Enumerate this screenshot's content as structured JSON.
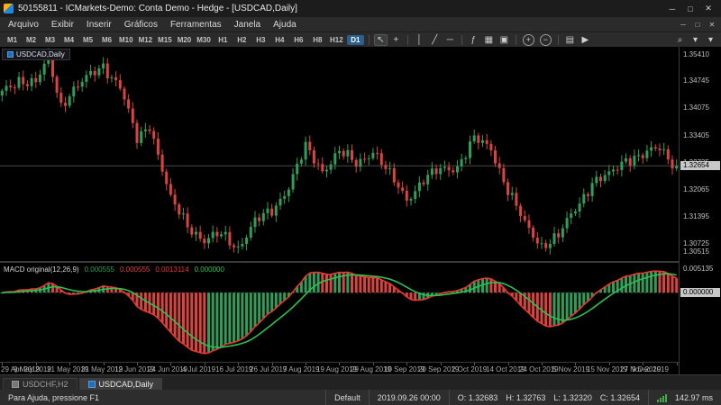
{
  "window": {
    "title": "50155811 - ICMarkets-Demo: Conta Demo - Hedge - [USDCAD,Daily]",
    "controls": {
      "minimize": "─",
      "maximize": "□",
      "close": "✕"
    }
  },
  "menu": {
    "items": [
      "Arquivo",
      "Exibir",
      "Inserir",
      "Gráficos",
      "Ferramentas",
      "Janela",
      "Ajuda"
    ],
    "child_controls": {
      "minimize": "─",
      "restore": "□",
      "close": "✕"
    }
  },
  "toolbar": {
    "timeframes": [
      "M1",
      "M2",
      "M3",
      "M4",
      "M5",
      "M6",
      "M10",
      "M12",
      "M15",
      "M20",
      "M30",
      "H1",
      "H2",
      "H3",
      "H4",
      "H6",
      "H8",
      "H12",
      "D1"
    ],
    "active_timeframe": "D1",
    "tools": [
      {
        "name": "cursor",
        "glyph": "↖",
        "pressed": true
      },
      {
        "name": "crosshair",
        "glyph": "+"
      },
      {
        "sep": true
      },
      {
        "name": "vertical-line",
        "glyph": "│"
      },
      {
        "name": "trendline",
        "glyph": "╱"
      },
      {
        "name": "horizontal-line",
        "glyph": "─"
      },
      {
        "sep": true
      },
      {
        "name": "indicators",
        "glyph": "ƒ"
      },
      {
        "name": "indicator-windows",
        "glyph": "▦"
      },
      {
        "name": "objects-list",
        "glyph": "▣"
      },
      {
        "sep": true
      },
      {
        "name": "zoom-in",
        "glyph": "+",
        "circled": true
      },
      {
        "name": "zoom-out",
        "glyph": "−",
        "circled": true
      },
      {
        "sep": true
      },
      {
        "name": "tile-windows",
        "glyph": "▤"
      },
      {
        "name": "algo-trading",
        "glyph": "▶"
      }
    ],
    "tools_right": [
      {
        "name": "search",
        "glyph": "⌕"
      },
      {
        "name": "favorites-dropdown",
        "glyph": "▾"
      },
      {
        "name": "toolbars-dropdown",
        "glyph": "▾"
      }
    ]
  },
  "chart": {
    "symbol_label": "USDCAD,Daily",
    "current_price": "1.32654",
    "price_top": 1.356,
    "price_bottom": 1.303,
    "price_axis": [
      "1.35410",
      "1.34745",
      "1.34075",
      "1.33405",
      "1.32735",
      "1.32065",
      "1.31395",
      "1.30725",
      "1.30515"
    ],
    "dates": [
      "29 Apr 2019",
      "9 May 2019",
      "21 May 2019",
      "31 May 2019",
      "12 Jun 2019",
      "24 Jun 2019",
      "4 Jul 2019",
      "16 Jul 2019",
      "26 Jul 2019",
      "7 Aug 2019",
      "19 Aug 2019",
      "29 Aug 2019",
      "10 Sep 2019",
      "20 Sep 2019",
      "2 Oct 2019",
      "14 Oct 2019",
      "24 Oct 2019",
      "5 Nov 2019",
      "15 Nov 2019",
      "27 Nov 2019",
      "9 Dec 2019"
    ]
  },
  "macd": {
    "label": "MACD original(12,26,9)",
    "values": [
      "0.000555",
      "0.000555",
      "0.0013114",
      "0.000000"
    ],
    "value_colors": [
      "#2f9e5b",
      "#d9443f",
      "#e8392e",
      "#2fc04e"
    ],
    "axis": [
      {
        "v": "0.005135",
        "hl": false
      },
      {
        "v": "0.000000",
        "hl": true
      }
    ]
  },
  "chart_data": {
    "type": "candlestick",
    "symbol": "USDCAD",
    "timeframe": "Daily",
    "candles": 161,
    "label_spacing_days": 8,
    "close_anchors": [
      [
        0,
        1.3445
      ],
      [
        4,
        1.348
      ],
      [
        8,
        1.347
      ],
      [
        11,
        1.353
      ],
      [
        14,
        1.3415
      ],
      [
        16,
        1.3445
      ],
      [
        20,
        1.348
      ],
      [
        24,
        1.3515
      ],
      [
        28,
        1.346
      ],
      [
        32,
        1.333
      ],
      [
        35,
        1.337
      ],
      [
        40,
        1.318
      ],
      [
        44,
        1.312
      ],
      [
        48,
        1.308
      ],
      [
        52,
        1.3095
      ],
      [
        56,
        1.3065
      ],
      [
        60,
        1.3125
      ],
      [
        64,
        1.3155
      ],
      [
        68,
        1.3215
      ],
      [
        72,
        1.331
      ],
      [
        76,
        1.3255
      ],
      [
        80,
        1.33
      ],
      [
        84,
        1.327
      ],
      [
        88,
        1.3305
      ],
      [
        92,
        1.324
      ],
      [
        96,
        1.3185
      ],
      [
        100,
        1.323
      ],
      [
        104,
        1.3255
      ],
      [
        108,
        1.3265
      ],
      [
        112,
        1.333
      ],
      [
        116,
        1.331
      ],
      [
        120,
        1.3205
      ],
      [
        124,
        1.312
      ],
      [
        128,
        1.307
      ],
      [
        132,
        1.309
      ],
      [
        136,
        1.316
      ],
      [
        140,
        1.3225
      ],
      [
        144,
        1.324
      ],
      [
        148,
        1.3285
      ],
      [
        152,
        1.329
      ],
      [
        156,
        1.331
      ],
      [
        160,
        1.32654
      ]
    ],
    "macd_params": [
      12,
      26,
      9
    ]
  },
  "colors": {
    "up": "#2f9e5b",
    "down": "#d9443f",
    "macd_line": "#e8392e",
    "signal_line": "#2fc04e",
    "active_timeframe_bg": "#2b5f8e",
    "current_price_line": "#4a4a4a"
  },
  "tabs": [
    {
      "label": "USDCHF,H2",
      "active": false
    },
    {
      "label": "USDCAD,Daily",
      "active": true
    }
  ],
  "status": {
    "help": "Para Ajuda, pressione F1",
    "profile": "Default",
    "time": "2019.09.26 00:00",
    "ohlc": [
      "O: 1.32683",
      "H: 1.32763",
      "L: 1.32320",
      "C: 1.32654"
    ],
    "ping": "142.97 ms"
  }
}
